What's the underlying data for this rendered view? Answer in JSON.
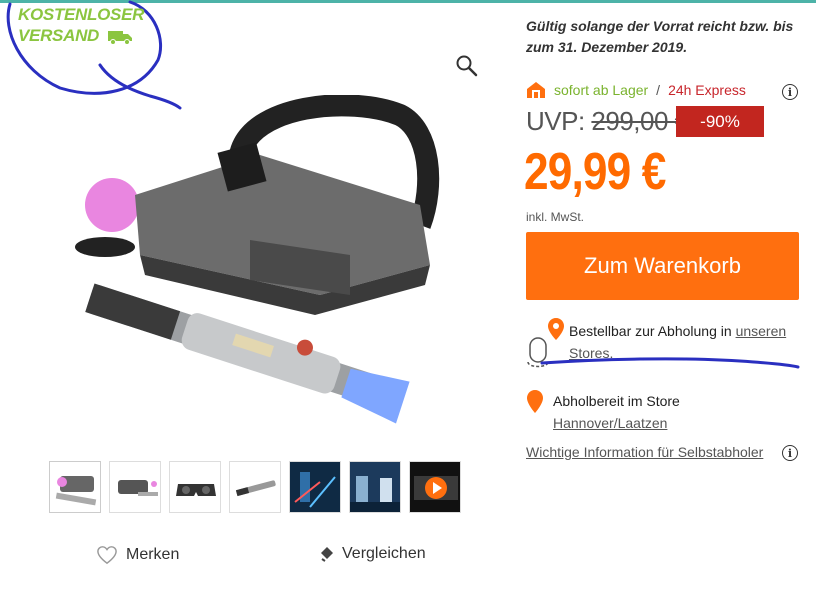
{
  "badge": {
    "line1": "KOSTENLOSER",
    "line2": "VERSAND"
  },
  "icons": {
    "truck": "truck-icon",
    "zoom": "magnifier-icon",
    "heart": "heart-icon",
    "compare": "compare-icon",
    "store": "store-icon",
    "location": "location-pin-icon",
    "info": "info-icon",
    "play": "play-icon"
  },
  "validity": "Gültig solange der Vorrat reicht bzw. bis zum 31. Dezember 2019.",
  "stock": {
    "available": "sofort ab Lager",
    "separator": "/",
    "express": "24h Express"
  },
  "price": {
    "uvp_label": "UVP:",
    "uvp_value": "299,00 €",
    "discount": "-90%",
    "current": "29,99 €",
    "vat": "inkl. MwSt."
  },
  "cart_button": "Zum Warenkorb",
  "pickup": {
    "text": "Bestellbar zur Abholung in ",
    "link": "unseren Stores."
  },
  "store": {
    "label": "Abholbereit im Store",
    "link": "Hannover/Laatzen"
  },
  "info_link": "Wichtige Information für Selbstabholer",
  "actions": {
    "merken": "Merken",
    "vergleichen": "Vergleichen"
  },
  "colors": {
    "accent": "#ff6f0f",
    "discount": "#c2261f",
    "green": "#7ab32e",
    "badge": "#8bc540",
    "scribble": "#2a2fc0"
  }
}
